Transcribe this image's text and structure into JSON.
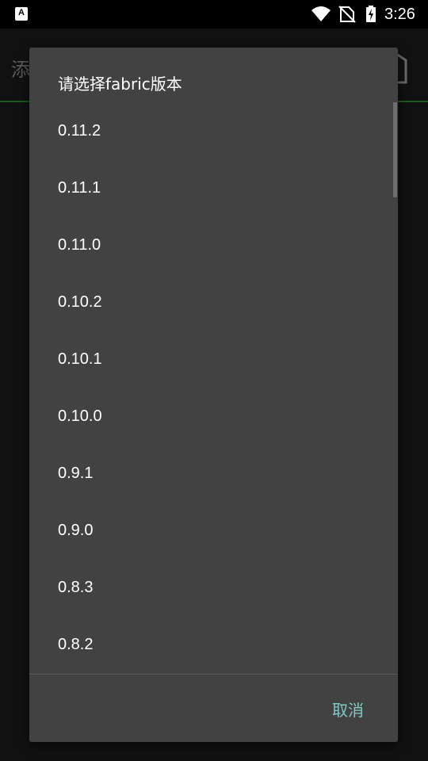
{
  "status_bar": {
    "time": "3:26",
    "left_icon_letter": "A",
    "icons": [
      "wifi-icon",
      "no-sim-icon",
      "battery-charging-icon"
    ]
  },
  "background_app": {
    "title_fragment": "添"
  },
  "dialog": {
    "title": "请选择fabric版本",
    "items": [
      "0.11.2",
      "0.11.1",
      "0.11.0",
      "0.10.2",
      "0.10.1",
      "0.10.0",
      "0.9.1",
      "0.9.0",
      "0.8.3",
      "0.8.2"
    ],
    "cancel_label": "取消"
  },
  "colors": {
    "dialog_bg": "#424242",
    "accent": "#80cbc4",
    "status_bar_bg": "#000000"
  }
}
